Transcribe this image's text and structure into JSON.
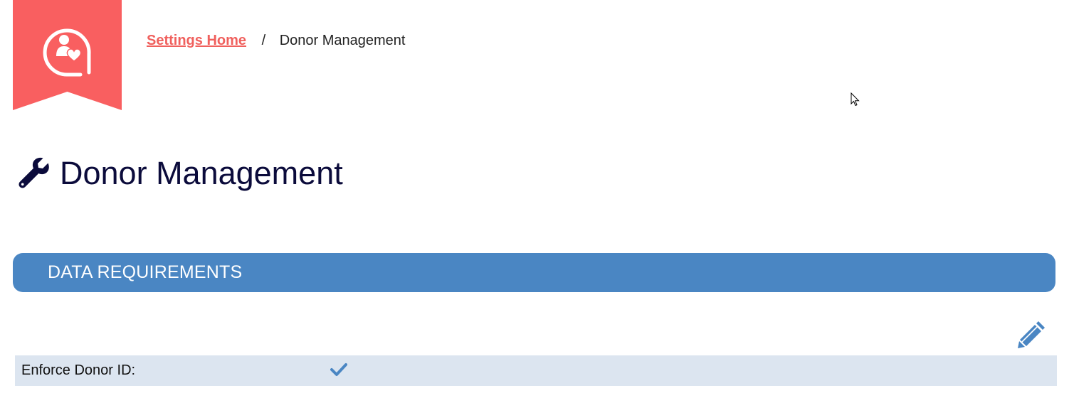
{
  "logo": {
    "icon": "donor-heart-icon",
    "brand_color": "#f95f60"
  },
  "breadcrumb": {
    "home_label": "Settings Home",
    "separator": "/",
    "current": "Donor Management"
  },
  "page": {
    "title": "Donor Management",
    "title_icon": "wrench-icon",
    "title_color": "#0b0b3b"
  },
  "section": {
    "title": "DATA REQUIREMENTS",
    "color": "#4a86c3",
    "edit_icon": "pencil-icon",
    "rows": [
      {
        "label": "Enforce Donor ID:",
        "value": "checked",
        "icon": "checkmark-icon"
      }
    ]
  }
}
